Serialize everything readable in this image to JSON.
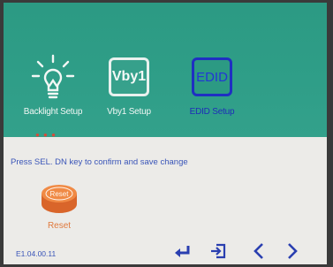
{
  "menu": {
    "items": [
      {
        "label": "Backlight Setup",
        "icon": "lightbulb-icon"
      },
      {
        "label": "Vby1 Setup",
        "icon_text": "Vby1"
      },
      {
        "label": "EDID Setup",
        "icon_text": "EDID",
        "selected": true
      }
    ]
  },
  "info": {
    "message": "Press SEL. DN key to confirm and save change"
  },
  "reset": {
    "icon_text": "Reset",
    "label": "Reset"
  },
  "footer": {
    "version": "E1.04.00.11",
    "buttons": [
      "enter-icon",
      "exit-icon",
      "chevron-left-icon",
      "chevron-right-icon"
    ]
  },
  "colors": {
    "menu_band": "#2f9e88",
    "selected": "#1f2fc2",
    "info_text": "#3a55b8",
    "reset_orange": "#e07a3e"
  }
}
